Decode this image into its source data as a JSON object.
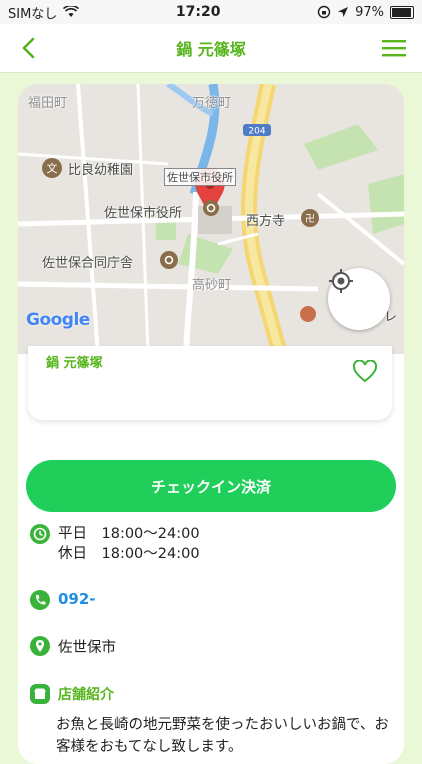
{
  "status_bar": {
    "carrier": "SIMなし",
    "time": "17:20",
    "battery": "97%"
  },
  "nav": {
    "title": "鍋 元篠塚"
  },
  "map": {
    "labels": {
      "fukuda": "福田町",
      "mantoku": "万徳町",
      "route": "204",
      "hirahara": "比良幼稚園",
      "cityhall_top": "佐世保市役所",
      "cityhall": "佐世保市役所",
      "saihoji": "西方寺",
      "godo": "佐世保合同庁舎",
      "takasago": "高砂町",
      "edge": "レ"
    },
    "attribution": "Google"
  },
  "shop": {
    "name": "鍋 元篠塚"
  },
  "checkin_label": "チェックイン決済",
  "hours": {
    "line1": "平日　18:00〜24:00",
    "line2": "休日　18:00〜24:00"
  },
  "phone": "092-",
  "address": "佐世保市",
  "intro": {
    "title": "店舗紹介",
    "text": "お魚と長崎の地元野菜を使ったおいしいお鍋で、お客様をおもてなし致します。"
  },
  "colors": {
    "brand_green": "#56b51d",
    "button_green": "#1fcf5a",
    "phone_blue": "#1e8ee6"
  }
}
